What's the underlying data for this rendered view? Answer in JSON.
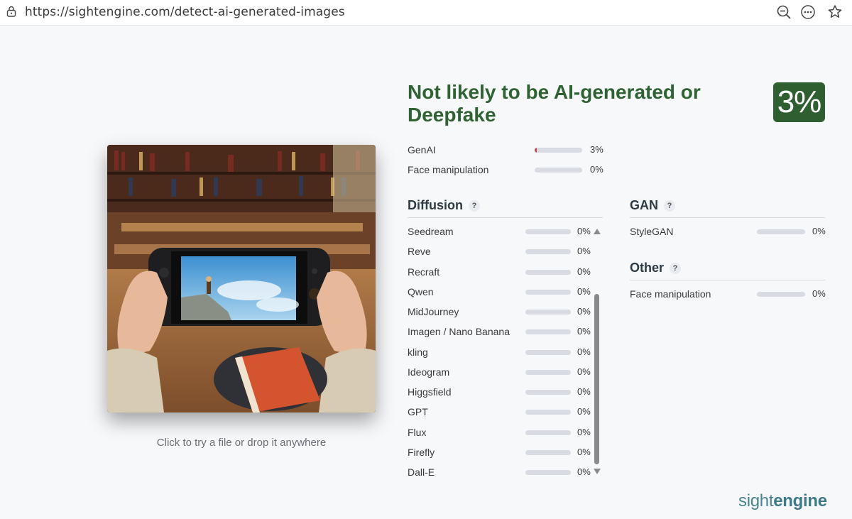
{
  "browser": {
    "url": "https://sightengine.com/detect-ai-generated-images"
  },
  "upload": {
    "hint": "Click to try a file or drop it anywhere"
  },
  "verdict": {
    "line1": "Not likely to be AI-generated or",
    "line2": "Deepfake",
    "score": "3%",
    "color": "#2f5e30"
  },
  "summary": [
    {
      "label": "GenAI",
      "value": "3%",
      "fraction": 0.03
    },
    {
      "label": "Face manipulation",
      "value": "0%",
      "fraction": 0
    }
  ],
  "diffusion": {
    "title": "Diffusion",
    "help": "?",
    "items": [
      {
        "label": "Seedream",
        "value": "0%"
      },
      {
        "label": "Reve",
        "value": "0%"
      },
      {
        "label": "Recraft",
        "value": "0%"
      },
      {
        "label": "Qwen",
        "value": "0%"
      },
      {
        "label": "MidJourney",
        "value": "0%"
      },
      {
        "label": "Imagen / Nano Banana",
        "value": "0%"
      },
      {
        "label": "kling",
        "value": "0%"
      },
      {
        "label": "Ideogram",
        "value": "0%"
      },
      {
        "label": "Higgsfield",
        "value": "0%"
      },
      {
        "label": "GPT",
        "value": "0%"
      },
      {
        "label": "Flux",
        "value": "0%"
      },
      {
        "label": "Firefly",
        "value": "0%"
      },
      {
        "label": "Dall-E",
        "value": "0%"
      }
    ]
  },
  "gan": {
    "title": "GAN",
    "help": "?",
    "items": [
      {
        "label": "StyleGAN",
        "value": "0%"
      }
    ]
  },
  "other": {
    "title": "Other",
    "help": "?",
    "items": [
      {
        "label": "Face manipulation",
        "value": "0%"
      }
    ]
  },
  "brand": {
    "part1": "sight",
    "part2": "engine"
  }
}
